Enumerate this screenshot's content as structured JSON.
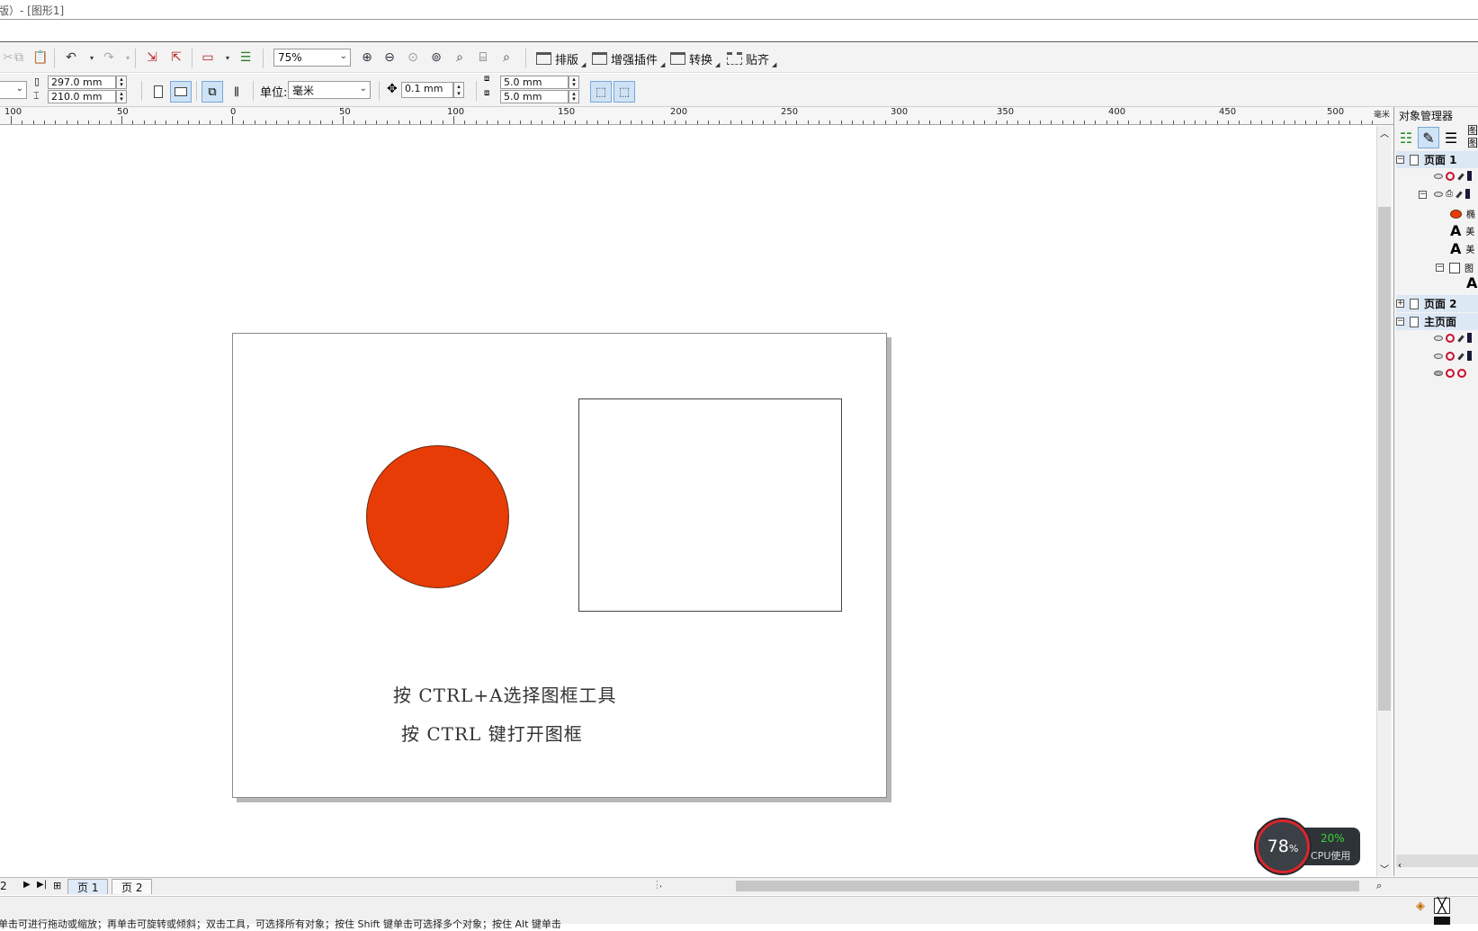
{
  "window": {
    "title": "版）- [图形1]"
  },
  "toolbar": {
    "zoom": "75%",
    "buttons": {
      "layout": "排版",
      "enhance": "增强插件",
      "convert": "转换",
      "snap": "贴齐"
    }
  },
  "propbar": {
    "width": "297.0 mm",
    "height": "210.0 mm",
    "unit_label": "单位:",
    "unit_value": "毫米",
    "nudge": "0.1 mm",
    "dup_x": "5.0 mm",
    "dup_y": "5.0 mm"
  },
  "ruler": {
    "labels": [
      "100",
      "50",
      "0",
      "50",
      "100",
      "150",
      "200",
      "250",
      "300",
      "350",
      "400",
      "450",
      "500"
    ],
    "unit": "毫米"
  },
  "canvas": {
    "text1": "按 CTRL+A选择图框工具",
    "text2": "按 CTRL 键打开图框",
    "circle_color": "#e83c06"
  },
  "docker": {
    "title": "对象管理器",
    "side_tabs": [
      "图",
      "图"
    ],
    "tree": {
      "page1": "页面 1",
      "page2": "页面 2",
      "master": "主页面",
      "obj1": "椭",
      "obj2": "美",
      "obj3": "美",
      "obj4": "图"
    }
  },
  "pagenav": {
    "count": "2",
    "tabs": [
      "页 1",
      "页 2"
    ]
  },
  "status": {
    "text": "单击可进行拖动或缩放；再单击可旋转或倾斜；双击工具，可选择所有对象；按住 Shift 键单击可选择多个对象；按住 Alt 键单击"
  },
  "cpu": {
    "ring_value": "78",
    "ring_unit": "%",
    "percent": "20%",
    "label": "CPU使用"
  }
}
